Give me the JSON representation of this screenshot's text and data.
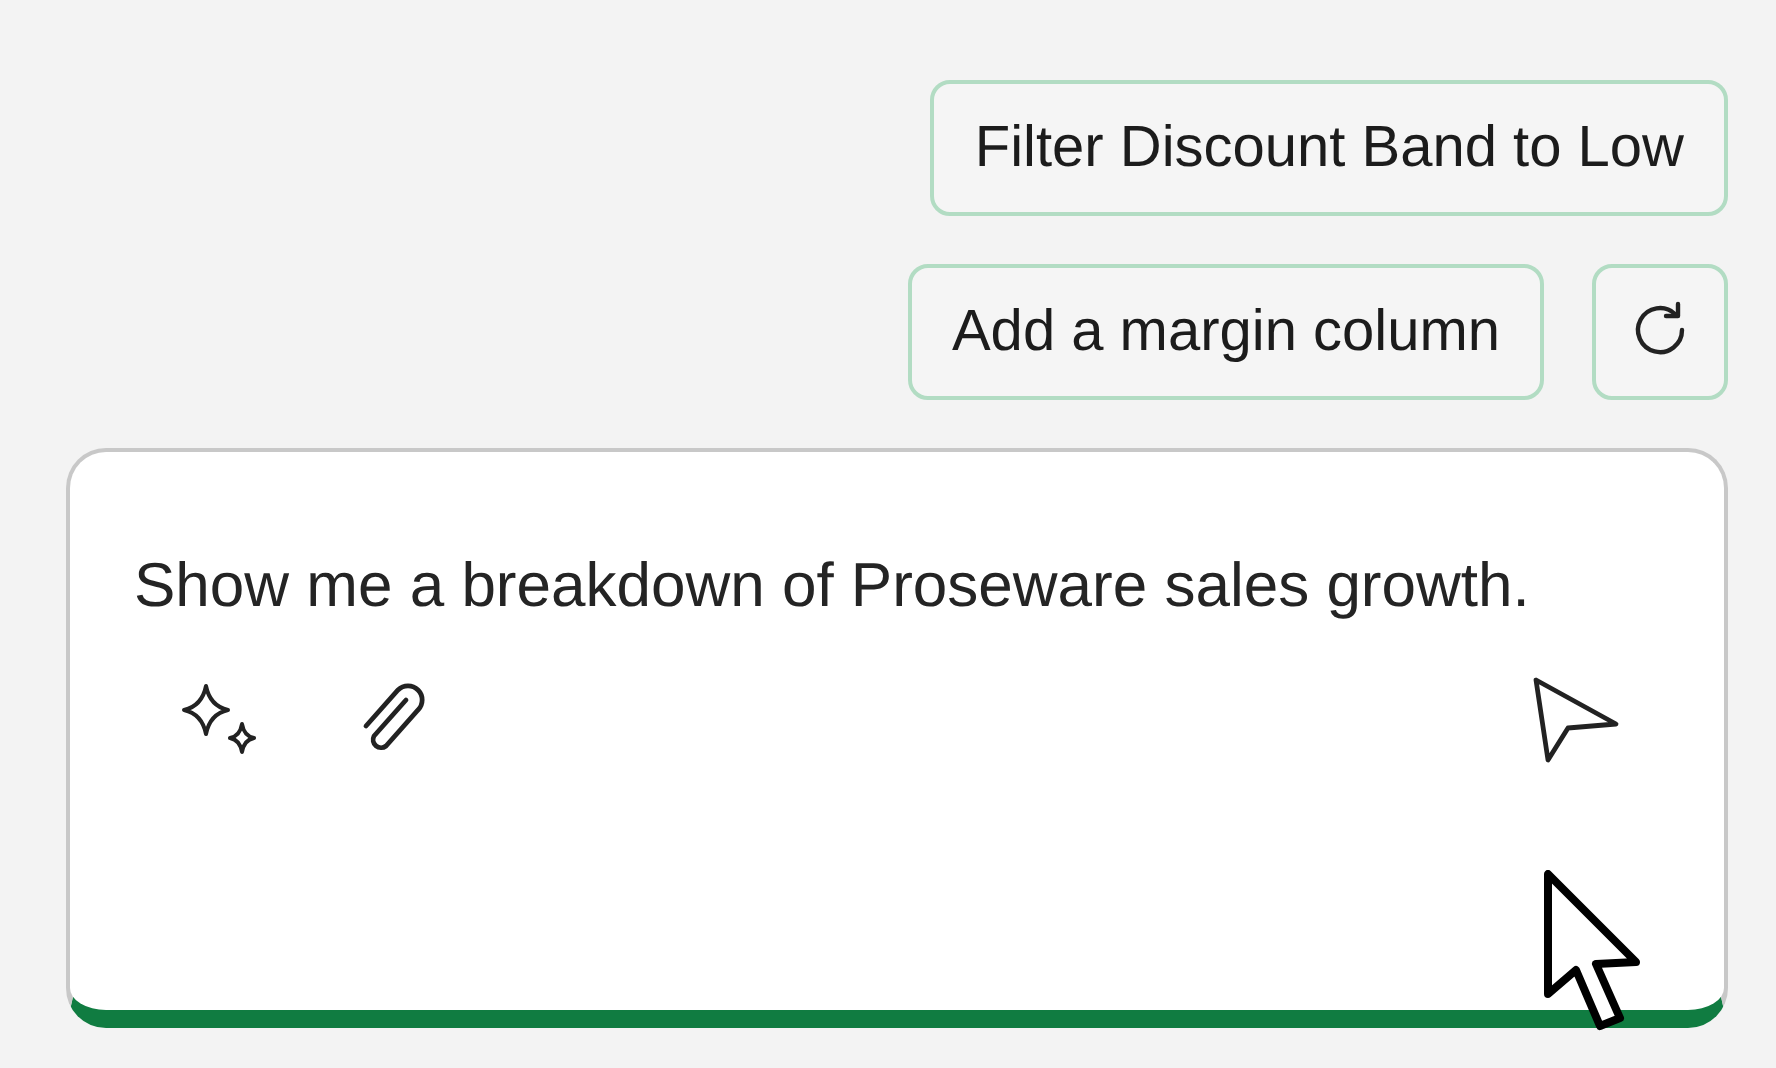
{
  "suggestions": [
    {
      "label": "Filter Discount Band to Low"
    },
    {
      "label": "Add a margin column"
    }
  ],
  "composer": {
    "value": "Show me a breakdown of Proseware sales growth."
  }
}
